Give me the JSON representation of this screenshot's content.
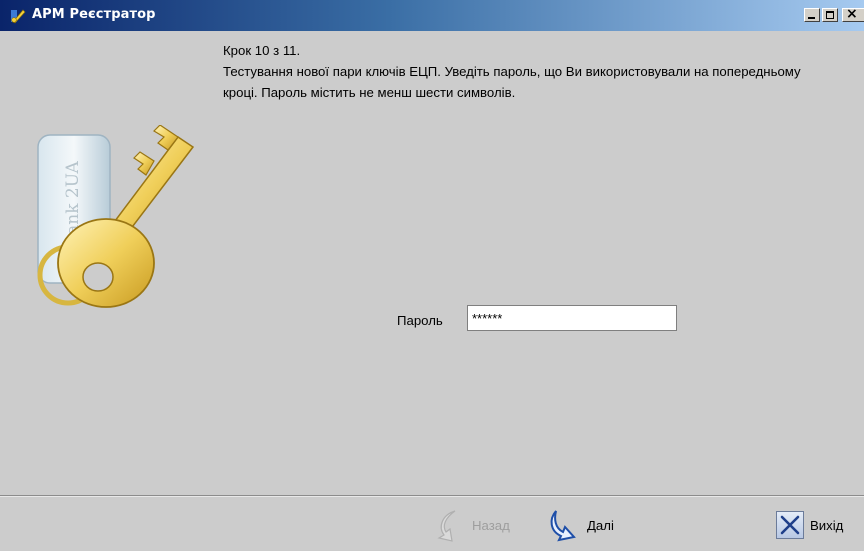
{
  "window": {
    "title": "АРМ Реєстратор",
    "controls": [
      "minimize-icon",
      "maximize-icon",
      "close-icon"
    ]
  },
  "graphic": {
    "tag_text": "iBank 2UA",
    "icon": "key-icon"
  },
  "wizard": {
    "step": "Крок 10 з 11.",
    "instruction": "Тестування нової пари ключів ЕЦП. Уведіть пароль, що Ви використовували на попередньому кроці. Пароль містить не менш шести символів."
  },
  "form": {
    "password_label": "Пароль",
    "password_value": "******"
  },
  "buttons": {
    "back": {
      "label": "Назад",
      "icon": "back-arrow-icon",
      "enabled": false
    },
    "next": {
      "label": "Далі",
      "icon": "next-arrow-icon",
      "enabled": true
    },
    "exit": {
      "label": "Вихід",
      "icon": "exit-x-icon",
      "enabled": true
    }
  },
  "colors": {
    "titlebar_start": "#0a246a",
    "titlebar_end": "#a6caf0",
    "background": "#cccccc",
    "disabled_text": "#9e9e9e",
    "arrow_blue": "#1f4fa8"
  }
}
